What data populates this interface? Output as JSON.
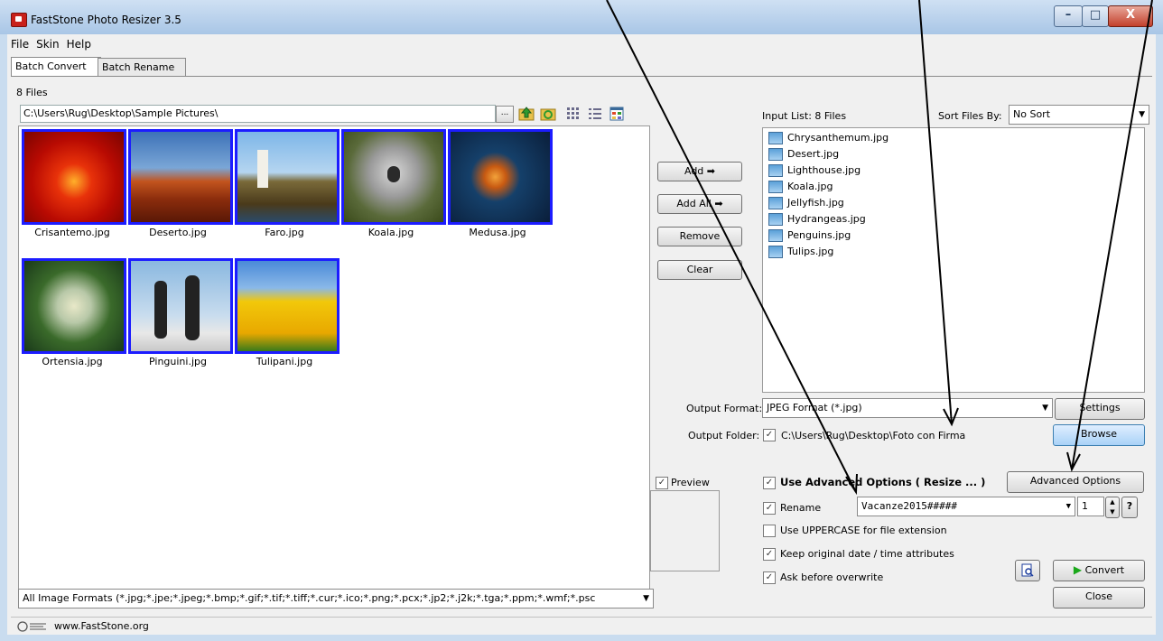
{
  "window": {
    "title": "FastStone Photo Resizer 3.5",
    "min_label": "–",
    "max_label": "□",
    "close_label": "X"
  },
  "menu": [
    "File",
    "Skin",
    "Help"
  ],
  "tabs": {
    "batch_convert": "Batch Convert",
    "batch_rename": "Batch Rename"
  },
  "files_count": "8 Files",
  "path": "C:\\Users\\Rug\\Desktop\\Sample Pictures\\",
  "browse_small": "...",
  "thumbnails": [
    {
      "label": "Crisantemo.jpg"
    },
    {
      "label": "Deserto.jpg"
    },
    {
      "label": "Faro.jpg"
    },
    {
      "label": "Koala.jpg"
    },
    {
      "label": "Medusa.jpg"
    },
    {
      "label": "Ortensia.jpg"
    },
    {
      "label": "Pinguini.jpg"
    },
    {
      "label": "Tulipani.jpg"
    }
  ],
  "formats": "All Image Formats (*.jpg;*.jpe;*.jpeg;*.bmp;*.gif;*.tif;*.tiff;*.cur;*.ico;*.png;*.pcx;*.jp2;*.j2k;*.tga;*.ppm;*.wmf;*.psc",
  "status": "www.FastStone.org",
  "actions": {
    "add": "Add ➡",
    "add_all": "Add All ➡",
    "remove": "Remove",
    "clear": "Clear"
  },
  "input_list": {
    "label": "Input List:  8 Files",
    "sort_label": "Sort Files By:",
    "sort_value": "No Sort",
    "files": [
      "Chrysanthemum.jpg",
      "Desert.jpg",
      "Lighthouse.jpg",
      "Koala.jpg",
      "Jellyfish.jpg",
      "Hydrangeas.jpg",
      "Penguins.jpg",
      "Tulips.jpg"
    ]
  },
  "output": {
    "format_label": "Output Format:",
    "format_value": "JPEG Format (*.jpg)",
    "settings": "Settings",
    "folder_label": "Output Folder:",
    "folder_value": "C:\\Users\\Rug\\Desktop\\Foto con Firma",
    "browse": "Browse"
  },
  "preview_label": "Preview",
  "options": {
    "use_advanced": "Use Advanced Options ( Resize ... )",
    "advanced_button": "Advanced Options",
    "rename": "Rename",
    "rename_value": "Vacanze2015#####",
    "start_number": "1",
    "help": "?",
    "uppercase": "Use UPPERCASE for file extension",
    "keep_date": "Keep original date / time attributes",
    "ask_overwrite": "Ask before overwrite",
    "check_mark": "✓"
  },
  "buttons": {
    "convert": "Convert",
    "close": "Close"
  }
}
